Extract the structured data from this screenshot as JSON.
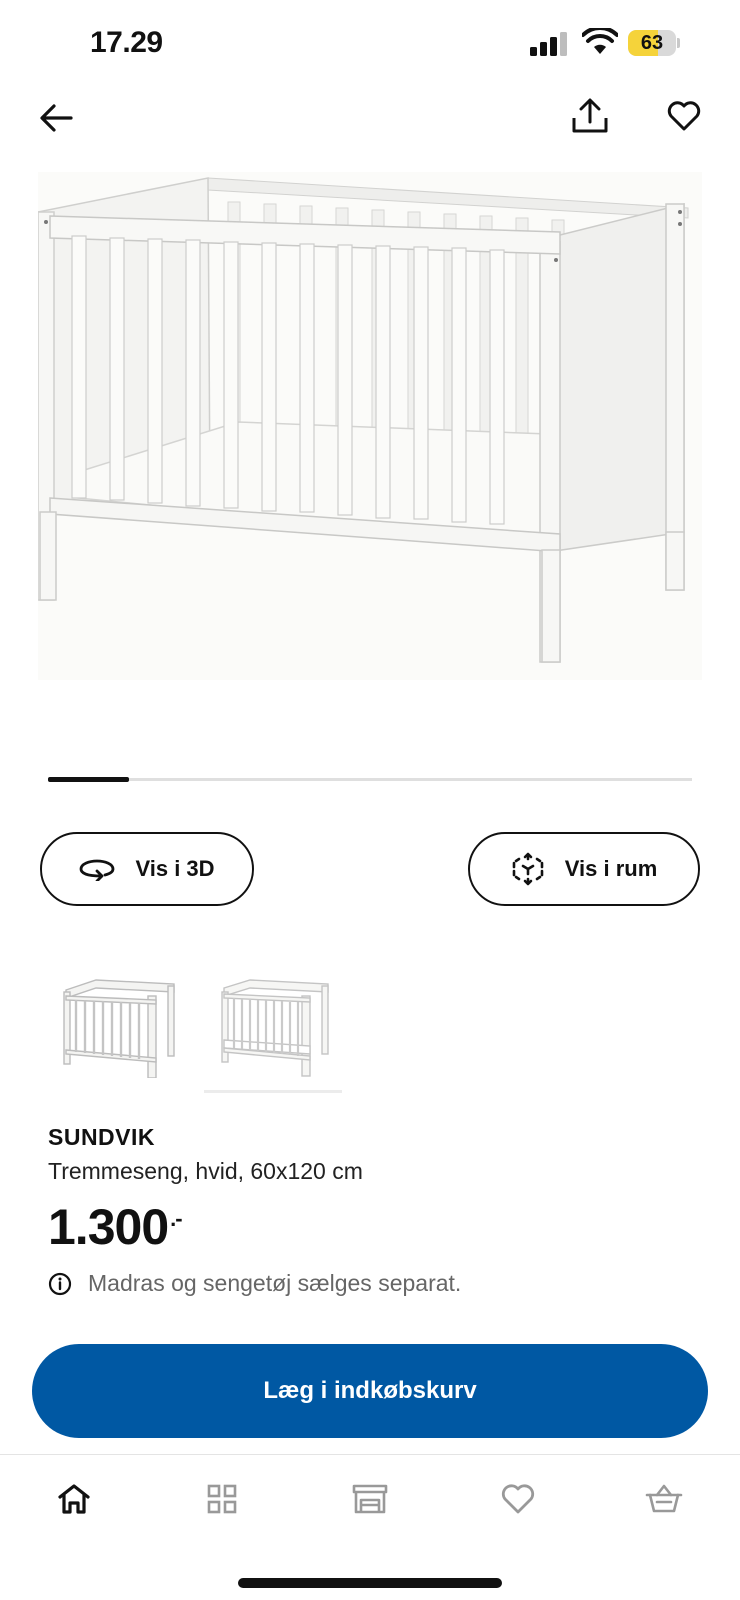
{
  "status_bar": {
    "time": "17.29",
    "battery_percent": "63",
    "battery_level": 0.63
  },
  "nav": {
    "back_icon": "arrow-left-icon",
    "share_icon": "share-icon",
    "favorite_icon": "heart-icon"
  },
  "gallery": {
    "image_position": 1,
    "image_count": 8
  },
  "actions": {
    "view_3d_label": "Vis i 3D",
    "view_room_label": "Vis i rum"
  },
  "product": {
    "name": "SUNDVIK",
    "description": "Tremmeseng, hvid, 60x120 cm",
    "price": "1.300",
    "price_suffix": ".-",
    "note": "Madras og sengetøj sælges separat."
  },
  "cta": {
    "label": "Læg i indkøbskurv"
  },
  "tabbar": {
    "items": [
      "home-icon",
      "grid-icon",
      "store-icon",
      "heart-icon",
      "basket-icon"
    ]
  },
  "colors": {
    "primary_blue": "#0058a3",
    "battery_yellow": "#f5d33a"
  }
}
